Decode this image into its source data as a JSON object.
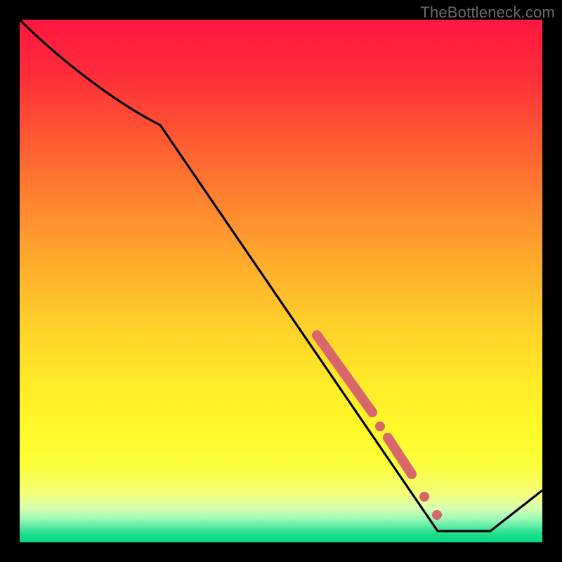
{
  "watermark": "TheBottleneck.com",
  "colors": {
    "line": "#000000",
    "marker": "#d8666a",
    "frame": "#000000"
  },
  "chart_data": {
    "type": "line",
    "title": "",
    "xlabel": "",
    "ylabel": "",
    "xlim": [
      0,
      100
    ],
    "ylim": [
      0,
      100
    ],
    "grid": false,
    "background": "vertical-gradient red→yellow→green (bottleneck heat scale)",
    "x": [
      0,
      27,
      80,
      90,
      100
    ],
    "values": [
      100,
      80,
      2,
      2,
      10
    ],
    "annotations": [
      {
        "type": "segment_highlight",
        "x": [
          56.9,
          67.5
        ],
        "y": [
          39.6,
          24.9
        ],
        "style": "thick-rounded",
        "color": "#d8666a"
      },
      {
        "type": "segment_highlight",
        "x": [
          70.5,
          75.0
        ],
        "y": [
          20.0,
          13.0
        ],
        "style": "thick-rounded",
        "color": "#d8666a"
      },
      {
        "type": "point",
        "x": 69.0,
        "y": 22.2,
        "color": "#d8666a"
      },
      {
        "type": "point",
        "x": 77.4,
        "y": 8.8,
        "color": "#d8666a"
      },
      {
        "type": "point",
        "x": 79.8,
        "y": 5.2,
        "color": "#d8666a"
      }
    ]
  }
}
